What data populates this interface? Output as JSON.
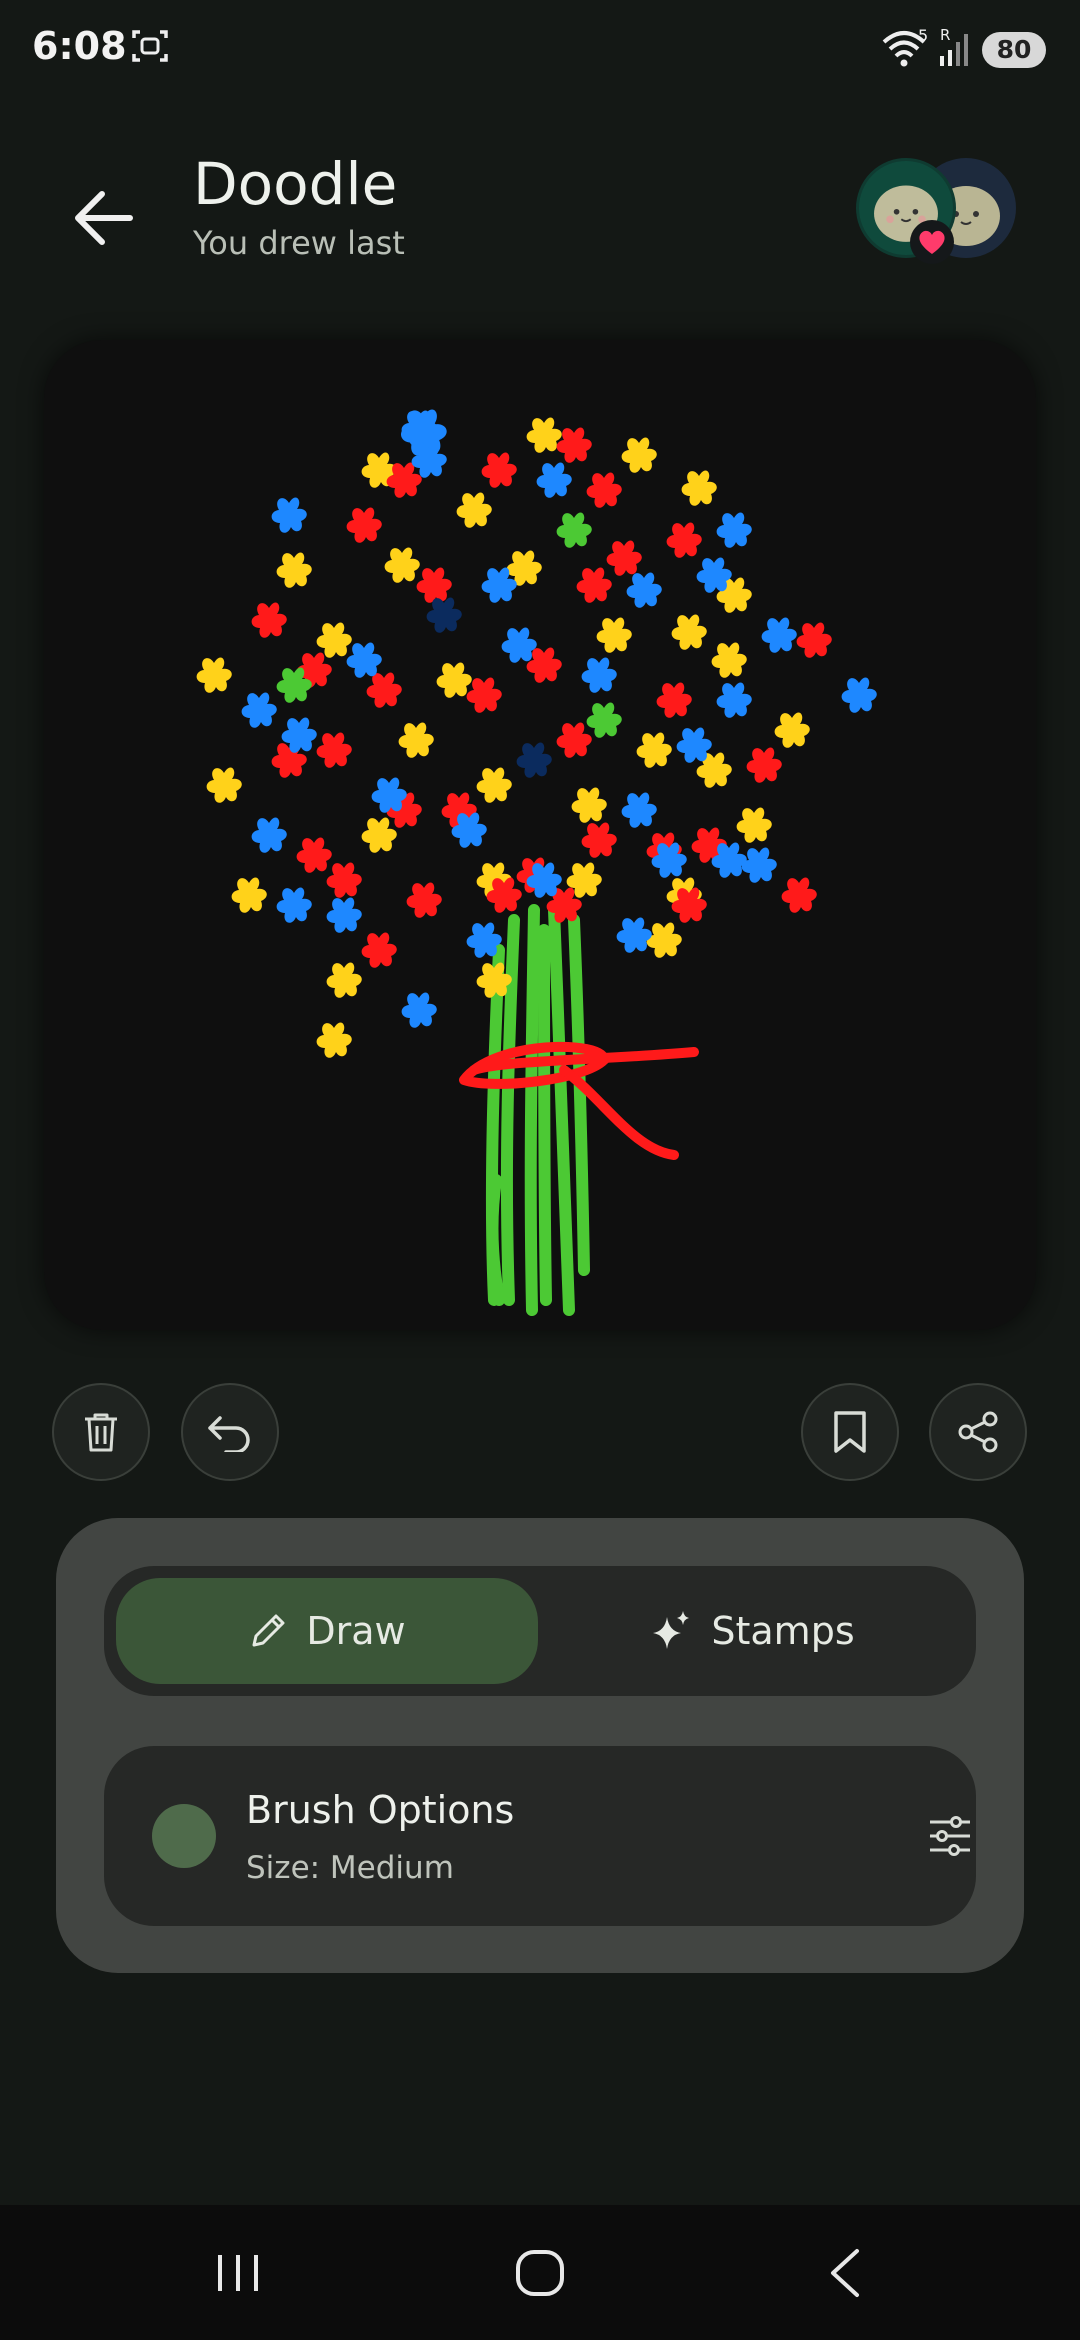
{
  "status_bar": {
    "time": "6:08",
    "wifi_badge": "5",
    "signal_badge": "R",
    "battery": "80"
  },
  "header": {
    "title": "Doodle",
    "subtitle": "You drew last",
    "back_icon": "arrow-left-icon",
    "avatar_badge_icon": "heart-icon"
  },
  "canvas": {
    "drawing": "flower-bouquet",
    "colors": {
      "red": "#ff1a1a",
      "yellow": "#ffd21a",
      "blue": "#1e88ff",
      "green": "#4cc934",
      "navy": "#0b2b5e"
    }
  },
  "toolbar": {
    "delete_icon": "trash-icon",
    "undo_icon": "undo-icon",
    "save_icon": "bookmark-icon",
    "share_icon": "share-icon"
  },
  "tool_panel": {
    "tabs": [
      {
        "label": "Draw",
        "icon": "pencil-icon",
        "selected": true
      },
      {
        "label": "Stamps",
        "icon": "sparkle-icon",
        "selected": false
      }
    ],
    "brush": {
      "title": "Brush Options",
      "size": "Size: Medium",
      "swatch_color": "#4f6b4b",
      "settings_icon": "sliders-icon"
    }
  },
  "nav_bar": {
    "recents_icon": "recents-icon",
    "home_icon": "home-icon",
    "back_icon": "back-chevron-icon"
  }
}
